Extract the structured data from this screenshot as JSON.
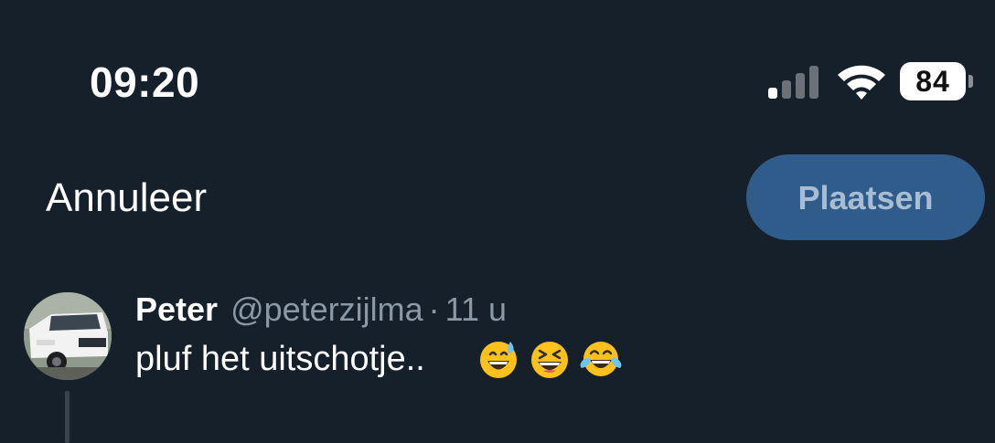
{
  "status_bar": {
    "time": "09:20",
    "battery": "84",
    "signal_bars_active": 1,
    "signal_bars_total": 4,
    "icons": [
      "cellular-signal-icon",
      "wifi-icon",
      "battery-icon"
    ]
  },
  "header": {
    "cancel_label": "Annuleer",
    "post_label": "Plaatsen"
  },
  "tweet": {
    "display_name": "Peter",
    "handle": "@peterzijlma",
    "separator": "·",
    "time": "11 u",
    "text": "pluf het uitschotje..",
    "emojis": [
      "grinning-face-with-sweat",
      "grinning-squinting-face",
      "face-with-tears-of-joy"
    ]
  },
  "colors": {
    "background": "#15202b",
    "accent_disabled": "#2f5c8a",
    "secondary_text": "#8b98a5",
    "thread_line": "#38444d"
  }
}
